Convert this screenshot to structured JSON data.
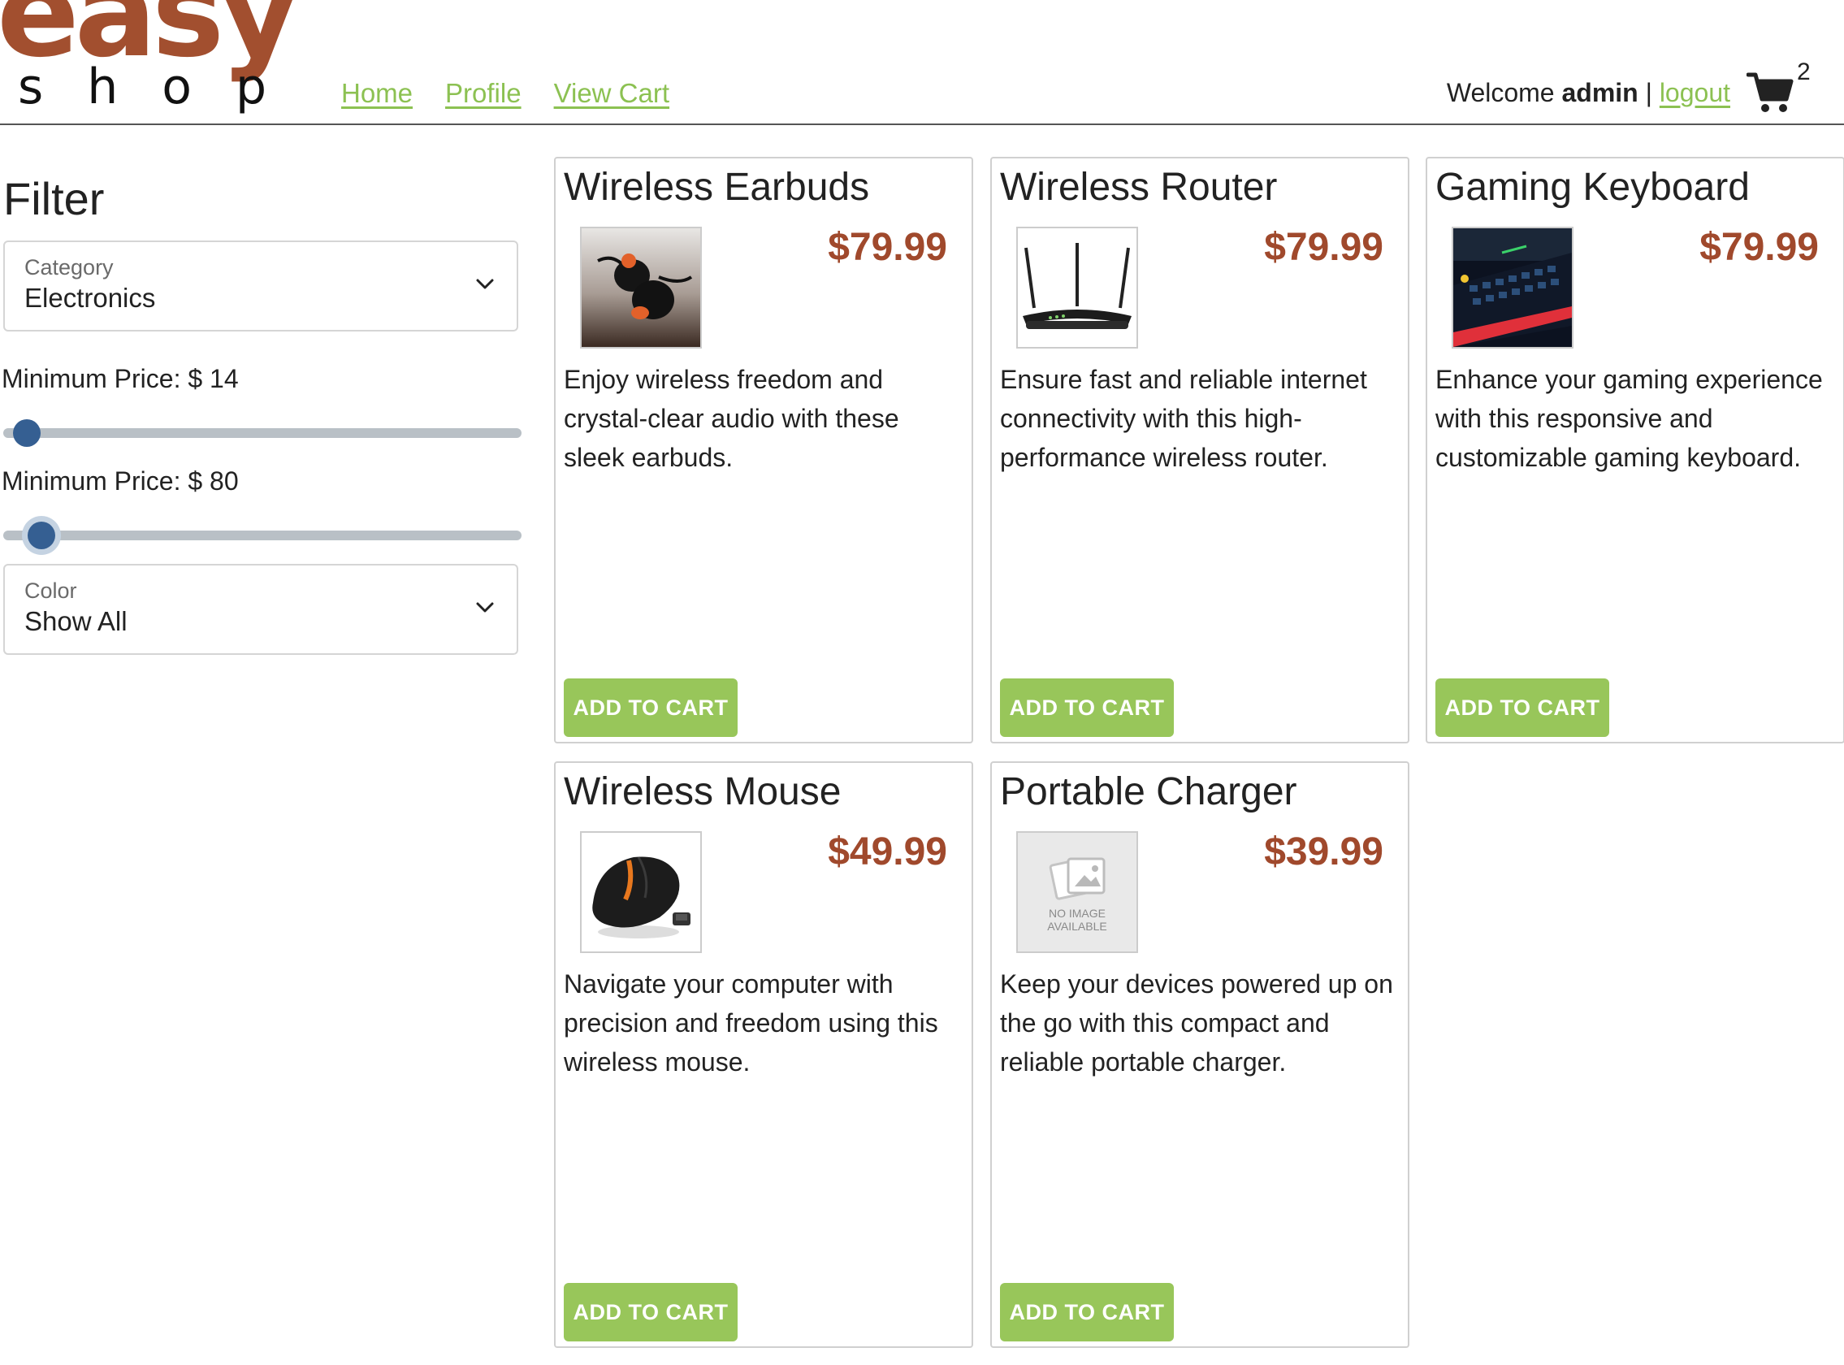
{
  "brand": {
    "logo_top": "easy",
    "logo_bottom": "shop"
  },
  "nav": {
    "home": "Home",
    "profile": "Profile",
    "cart": "View Cart"
  },
  "user": {
    "welcome": "Welcome",
    "name": "admin",
    "separator": "|",
    "logout": "logout"
  },
  "cart": {
    "count": "2",
    "icon": "shopping-cart-icon"
  },
  "filter": {
    "title": "Filter",
    "category": {
      "label": "Category",
      "value": "Electronics"
    },
    "min_price": {
      "label": "Minimum Price: $ 14",
      "value": 14,
      "fraction": 0.02
    },
    "max_price": {
      "label": "Minimum Price: $ 80",
      "value": 80,
      "fraction": 0.05
    },
    "color": {
      "label": "Color",
      "value": "Show All"
    }
  },
  "colors": {
    "brand": "#a24f2f",
    "link": "#8cc152",
    "button": "#98c65a",
    "price": "#a0492c",
    "slider_thumb": "#355f92"
  },
  "products": [
    {
      "name": "Wireless Earbuds",
      "price": "$79.99",
      "image": "earbuds-image",
      "description": "Enjoy wireless freedom and crystal-clear audio with these sleek earbuds.",
      "button": "ADD TO CART"
    },
    {
      "name": "Wireless Router",
      "price": "$79.99",
      "image": "router-image",
      "description": "Ensure fast and reliable internet connectivity with this high-performance wireless router.",
      "button": "ADD TO CART"
    },
    {
      "name": "Gaming Keyboard",
      "price": "$79.99",
      "image": "keyboard-image",
      "description": "Enhance your gaming experience with this responsive and customizable gaming keyboard.",
      "button": "ADD TO CART"
    },
    {
      "name": "Wireless Mouse",
      "price": "$49.99",
      "image": "mouse-image",
      "description": "Navigate your computer with precision and freedom using this wireless mouse.",
      "button": "ADD TO CART"
    },
    {
      "name": "Portable Charger",
      "price": "$39.99",
      "image": "no-image",
      "image_text": [
        "NO IMAGE",
        "AVAILABLE"
      ],
      "description": "Keep your devices powered up on the go with this compact and reliable portable charger.",
      "button": "ADD TO CART"
    }
  ]
}
